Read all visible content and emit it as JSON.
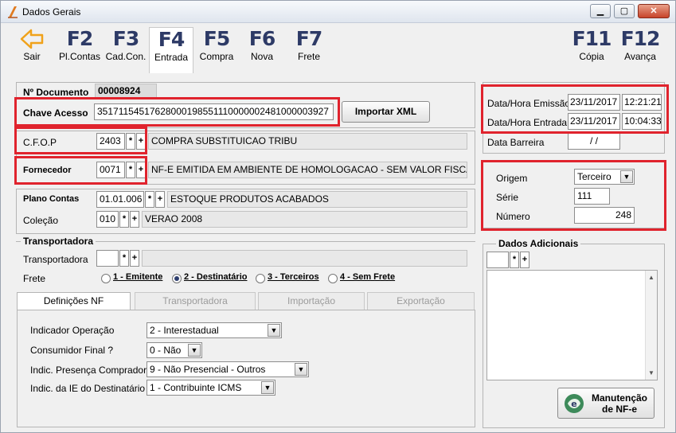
{
  "window": {
    "title": "Dados Gerais",
    "minimize": "▁",
    "maximize": "▢",
    "close": "✕"
  },
  "toolbar": {
    "sair": {
      "label": "Sair"
    },
    "f2": {
      "key": "F2",
      "label": "Pl.Contas"
    },
    "f3": {
      "key": "F3",
      "label": "Cad.Con."
    },
    "f4": {
      "key": "F4",
      "label": "Entrada"
    },
    "f5": {
      "key": "F5",
      "label": "Compra"
    },
    "f6": {
      "key": "F6",
      "label": "Nova"
    },
    "f7": {
      "key": "F7",
      "label": "Frete"
    },
    "f11": {
      "key": "F11",
      "label": "Cópia"
    },
    "f12": {
      "key": "F12",
      "label": "Avança"
    }
  },
  "documento": {
    "label": "Nº Documento",
    "value": "00008924",
    "chave_label": "Chave Acesso",
    "chave_value": "35171154517628000198551110000002481000003927",
    "importar": "Importar XML"
  },
  "cfop": {
    "label": "C.F.O.P",
    "code": "2403",
    "desc": "COMPRA SUBSTITUICAO TRIBU"
  },
  "fornecedor": {
    "label": "Fornecedor",
    "code": "0071",
    "desc": "NF-E EMITIDA EM AMBIENTE DE HOMOLOGACAO - SEM VALOR FISCAL"
  },
  "plano": {
    "label": "Plano Contas",
    "code": "01.01.006",
    "desc": "ESTOQUE PRODUTOS ACABADOS"
  },
  "colecao": {
    "label": "Coleção",
    "code": "010",
    "desc": "VERAO 2008"
  },
  "buttons": {
    "star": "*",
    "plus": "+"
  },
  "transportadora": {
    "legend": "Transportadora",
    "label": "Transportadora",
    "frete_label": "Frete",
    "frete_options": [
      "1 - Emitente",
      "2 - Destinatário",
      "3 - Terceiros",
      "4 - Sem Frete"
    ],
    "frete_selected_index": 1
  },
  "tabs": [
    "Definições NF",
    "Transportadora",
    "Importação",
    "Exportação"
  ],
  "definicoes": {
    "indicador_label": "Indicador Operação",
    "indicador_value": "2 - Interestadual",
    "consumidor_label": "Consumidor Final ?",
    "consumidor_value": "0 - Não",
    "presenca_label": "Indic. Presença Comprador",
    "presenca_value": "9 - Não Presencial - Outros",
    "ie_label": "Indic. da IE do Destinatário",
    "ie_value": "1 - Contribuinte ICMS"
  },
  "datas": {
    "emissao_label": "Data/Hora Emissão",
    "emissao_date": "23/11/2017",
    "emissao_time": "12:21:21",
    "entrada_label": "Data/Hora Entrada",
    "entrada_date": "23/11/2017",
    "entrada_time": "10:04:33",
    "barreira_label": "Data Barreira",
    "barreira_value": "/ /"
  },
  "origem": {
    "origem_label": "Origem",
    "origem_value": "Terceiro",
    "serie_label": "Série",
    "serie_value": "111",
    "numero_label": "Número",
    "numero_value": "248"
  },
  "adicionais": {
    "legend": "Dados Adicionais"
  },
  "manutencao": {
    "line1": "Manutenção",
    "line2": "de NF-e"
  },
  "colors": {
    "highlight": "#e0232d",
    "fkey": "#2d3a66"
  }
}
